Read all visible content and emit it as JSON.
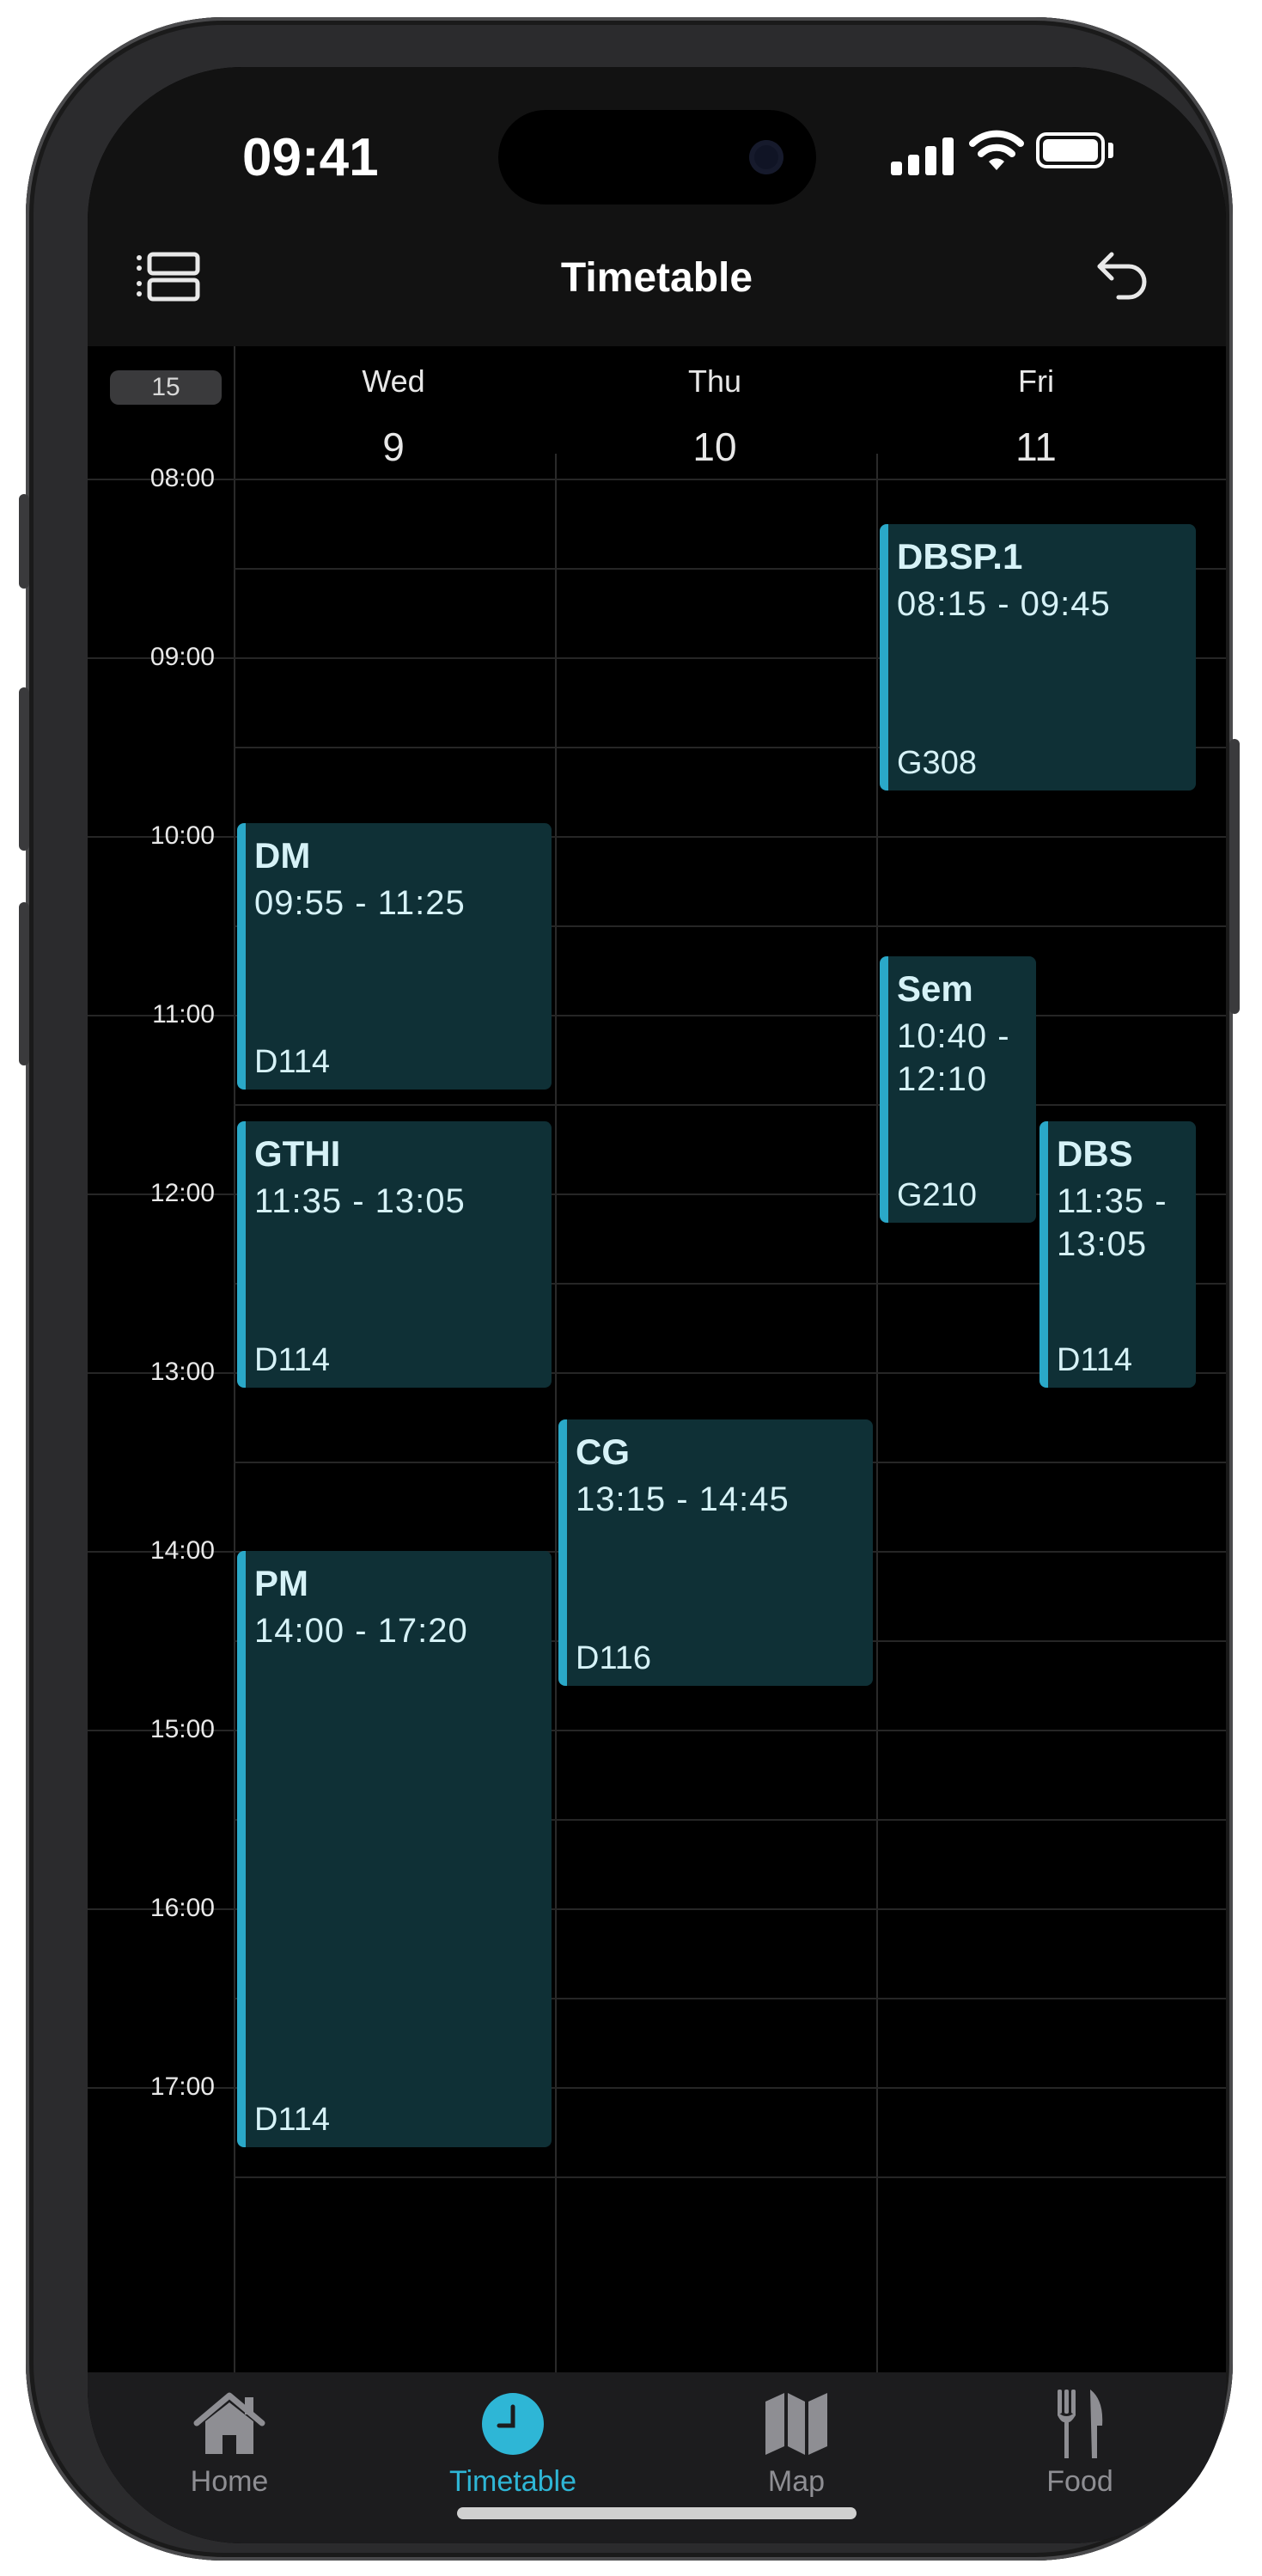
{
  "status_bar": {
    "time": "09:41"
  },
  "header": {
    "title": "Timetable"
  },
  "week_number": "15",
  "days": [
    {
      "name": "Wed",
      "date": "9"
    },
    {
      "name": "Thu",
      "date": "10"
    },
    {
      "name": "Fri",
      "date": "11"
    }
  ],
  "time_labels": [
    "08:00",
    "09:00",
    "10:00",
    "11:00",
    "12:00",
    "13:00",
    "14:00",
    "15:00",
    "16:00",
    "17:00"
  ],
  "events": [
    {
      "name": "DBSP.1",
      "time": "08:15 - 09:45",
      "room": "G308"
    },
    {
      "name": "DM",
      "time": "09:55 - 11:25",
      "room": "D114"
    },
    {
      "name": "Sem",
      "time": "10:40 - 12:10",
      "room": "G210"
    },
    {
      "name": "GTHI",
      "time": "11:35 - 13:05",
      "room": "D114"
    },
    {
      "name": "DBS",
      "time": "11:35 - 13:05",
      "room": "D114"
    },
    {
      "name": "CG",
      "time": "13:15 - 14:45",
      "room": "D116"
    },
    {
      "name": "PM",
      "time": "14:00 - 17:20",
      "room": "D114"
    }
  ],
  "tabs": [
    {
      "label": "Home",
      "icon": "house-icon"
    },
    {
      "label": "Timetable",
      "icon": "clock-icon",
      "active": true
    },
    {
      "label": "Map",
      "icon": "map-icon"
    },
    {
      "label": "Food",
      "icon": "fork-knife-icon"
    }
  ],
  "colors": {
    "accent": "#2eb6d6",
    "event_bg": "#0f3036",
    "event_border": "#2aa8c8"
  }
}
